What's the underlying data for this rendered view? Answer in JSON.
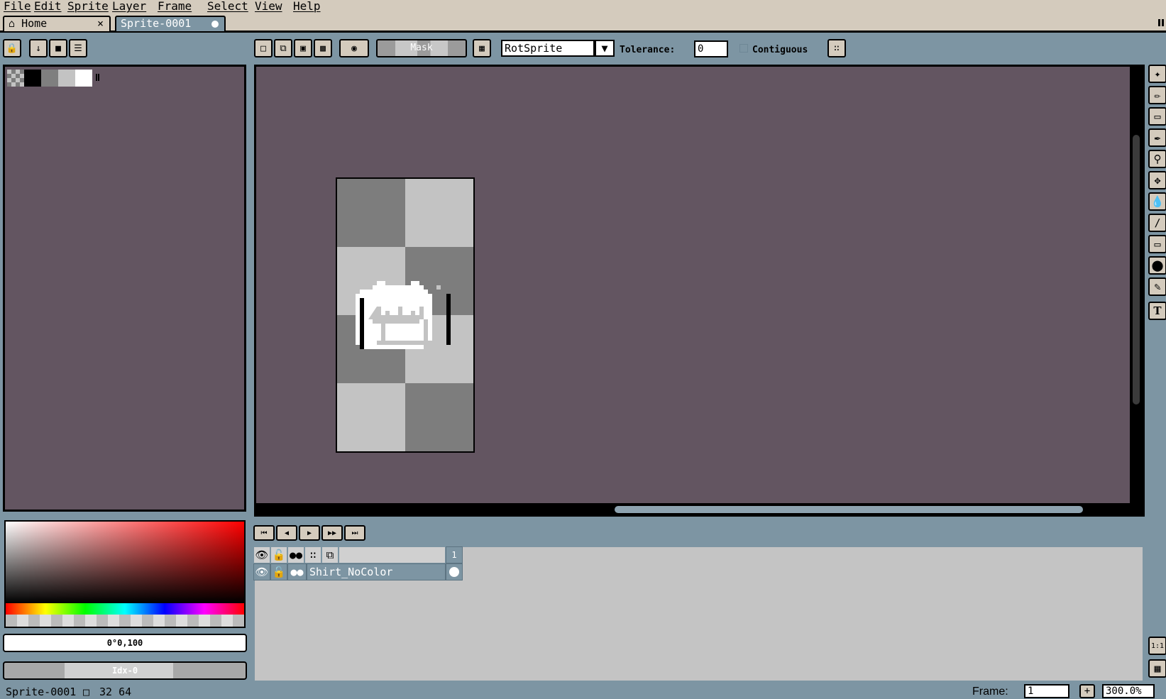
{
  "menu": {
    "items": [
      "File",
      "Edit",
      "Sprite",
      "Layer",
      "Frame",
      "Select",
      "View",
      "Help"
    ]
  },
  "tabs": {
    "home_label": "Home",
    "home_close": "×",
    "sprite_label": "Sprite-0001"
  },
  "toolbar": {
    "mask_label": "Mask",
    "rotation_algorithm": "RotSprite",
    "tolerance_label": "Tolerance:",
    "tolerance_value": "0",
    "contiguous_label": "Contiguous"
  },
  "palette": {
    "swatches": [
      "checker",
      "#000000",
      "#7f7f7f",
      "#c3c3c3",
      "#ffffff"
    ]
  },
  "color": {
    "value_text": "0°0,100",
    "index_text": "Idx-0"
  },
  "timeline": {
    "frame_number": "1",
    "layer_name": "Shirt_NoColor"
  },
  "status": {
    "sprite_name": "Sprite-0001",
    "size": "32 64",
    "frame_label": "Frame:",
    "frame_value": "1",
    "add_frame": "+",
    "zoom_value": "300.0%"
  },
  "colors": {
    "menu_bg": "#d4cbbd",
    "workspace_bg": "#7d95a3",
    "editor_bg": "#635561",
    "checker_dark": "#7d7d7d",
    "checker_light": "#c3c3c3"
  }
}
